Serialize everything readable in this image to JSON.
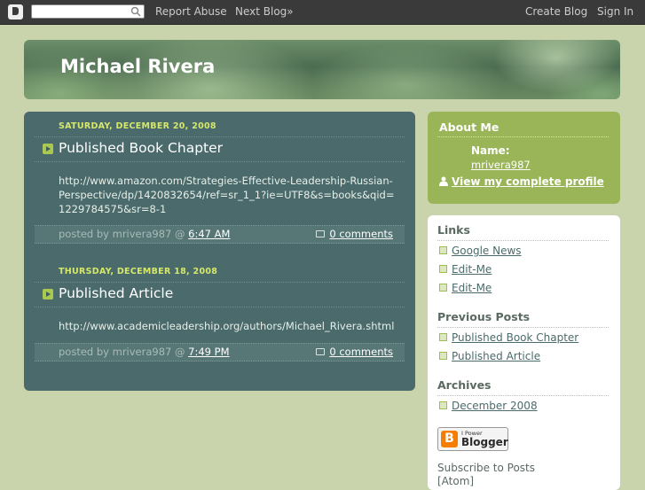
{
  "navbar": {
    "search_placeholder": "",
    "report_abuse": "Report Abuse",
    "next_blog": "Next Blog»",
    "create_blog": "Create Blog",
    "sign_in": "Sign In"
  },
  "header": {
    "title": "Michael Rivera"
  },
  "posts": [
    {
      "date": "SATURDAY, DECEMBER 20, 2008",
      "title": "Published Book Chapter",
      "body": "http://www.amazon.com/Strategies-Effective-Leadership-Russian-Perspective/dp/1420832654/ref=sr_1_1?ie=UTF8&s=books&qid=1229784575&sr=8-1",
      "posted_by": "posted by mrivera987 @",
      "time": "6:47 AM",
      "comments": "0 comments"
    },
    {
      "date": "THURSDAY, DECEMBER 18, 2008",
      "title": "Published Article",
      "body": "http://www.academicleadership.org/authors/Michael_Rivera.shtml",
      "posted_by": "posted by mrivera987 @",
      "time": "7:49 PM",
      "comments": "0 comments"
    }
  ],
  "about": {
    "title": "About Me",
    "name_label": "Name:",
    "name": "mrivera987",
    "profile_link": "View my complete profile"
  },
  "sidebar": {
    "links_title": "Links",
    "links": [
      "Google News",
      "Edit-Me",
      "Edit-Me"
    ],
    "previous_title": "Previous Posts",
    "previous": [
      "Published Book Chapter",
      "Published Article"
    ],
    "archives_title": "Archives",
    "archives": [
      "December 2008"
    ],
    "power_top": "I Power",
    "power_bottom": "Blogger",
    "subscribe": "Subscribe to Posts [Atom]"
  },
  "colors": {
    "page_bg": "#c9d4ad",
    "navbar_bg": "#3a3a3a",
    "main_bg": "#4a6a6c",
    "accent_date": "#d6e86a",
    "about_bg": "#99b557",
    "link_text": "#4b6b6a"
  }
}
